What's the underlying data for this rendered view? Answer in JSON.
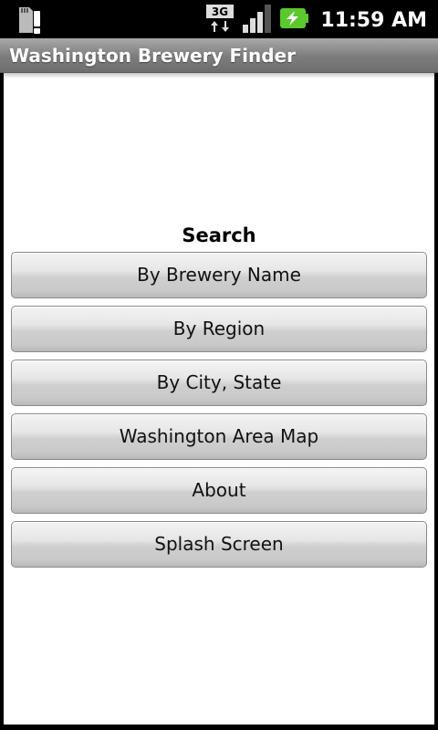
{
  "status_bar": {
    "network_type": "3G",
    "time": "11:59 AM",
    "icons": [
      "sd-card-alert-icon",
      "network-3g-icon",
      "signal-icon",
      "battery-charging-icon"
    ],
    "battery_color": "#5bc82d"
  },
  "app": {
    "title": "Washington Brewery Finder"
  },
  "search": {
    "heading": "Search",
    "buttons": [
      {
        "label": "By Brewery Name"
      },
      {
        "label": "By Region"
      },
      {
        "label": "By City, State"
      },
      {
        "label": "Washington Area Map"
      },
      {
        "label": "About"
      },
      {
        "label": "Splash Screen"
      }
    ]
  }
}
